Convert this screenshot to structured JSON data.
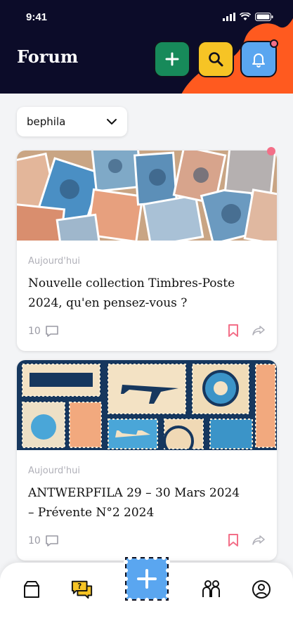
{
  "status": {
    "time": "9:41"
  },
  "header": {
    "title": "Forum",
    "buttons": [
      {
        "icon": "plus-icon",
        "color": "#178a5a"
      },
      {
        "icon": "search-icon",
        "color": "#f6c425"
      },
      {
        "icon": "bell-icon",
        "color": "#5aa6f0",
        "notification": true
      }
    ]
  },
  "filter": {
    "selected": "bephila"
  },
  "posts": [
    {
      "date": "Aujourd'hui",
      "title_line1": "Nouvelle collection Timbres-Poste",
      "title_line2": "2024, qu'en pensez-vous ?",
      "comments": "10",
      "unread": true
    },
    {
      "date": "Aujourd'hui",
      "title_line1": "ANTWERPFILA 29 – 30 Mars 2024",
      "title_line2": "– Prévente N°2 2024",
      "comments": "10",
      "unread": false
    }
  ],
  "nav": {
    "items": [
      "catalog-icon",
      "forum-icon",
      "add-icon",
      "community-icon",
      "profile-icon"
    ],
    "active": "forum-icon"
  },
  "colors": {
    "header_bg": "#0c0c29",
    "accent_orange": "#ff5a1f",
    "bookmark": "#f36f88",
    "fab": "#5aa6f0"
  }
}
